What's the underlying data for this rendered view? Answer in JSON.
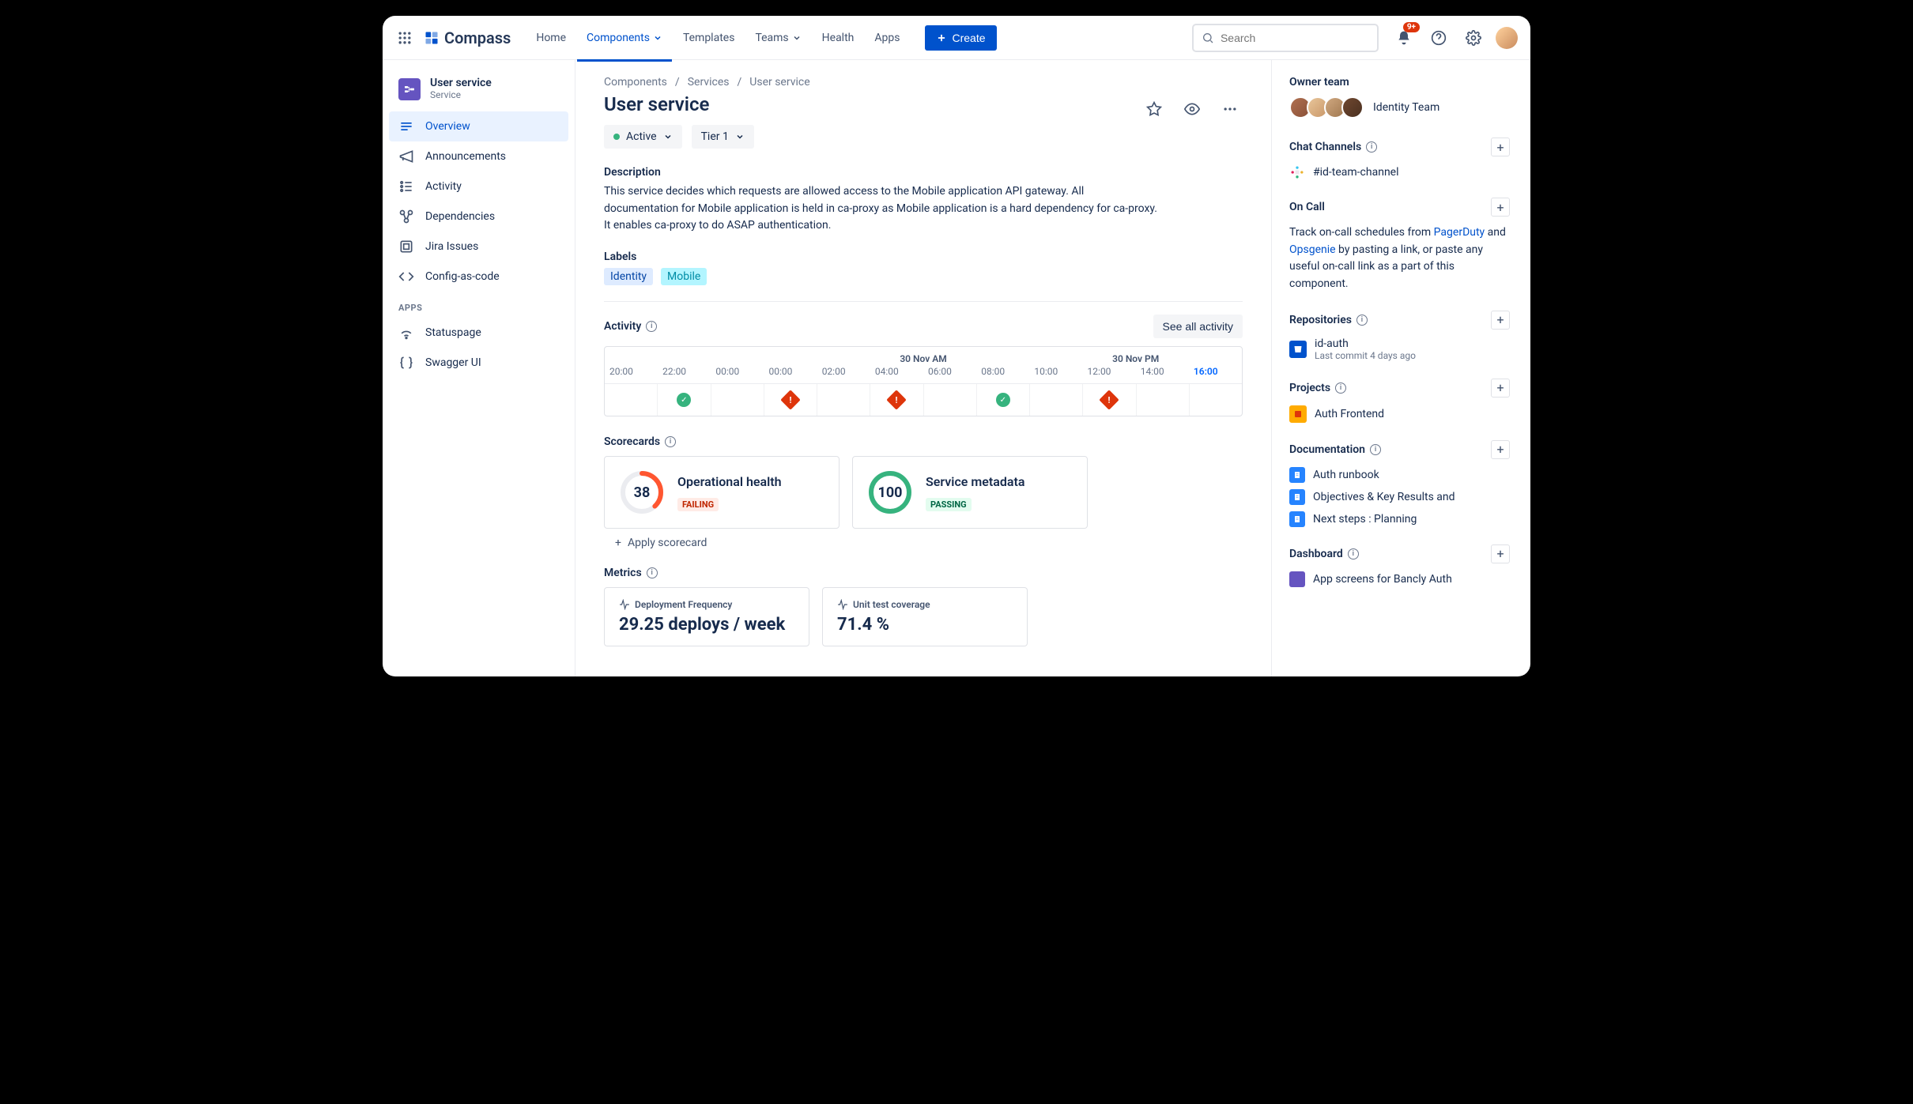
{
  "product": "Compass",
  "nav": {
    "items": [
      "Home",
      "Components",
      "Templates",
      "Teams",
      "Health",
      "Apps"
    ],
    "active": "Components",
    "create": "Create",
    "searchPlaceholder": "Search",
    "notifBadge": "9+"
  },
  "sidebar": {
    "title": "User service",
    "subtitle": "Service",
    "items": [
      {
        "label": "Overview",
        "icon": "overview"
      },
      {
        "label": "Announcements",
        "icon": "megaphone"
      },
      {
        "label": "Activity",
        "icon": "activity"
      },
      {
        "label": "Dependencies",
        "icon": "deps"
      },
      {
        "label": "Jira Issues",
        "icon": "jira"
      },
      {
        "label": "Config-as-code",
        "icon": "code"
      }
    ],
    "appsHeader": "APPS",
    "apps": [
      {
        "label": "Statuspage",
        "icon": "wifi"
      },
      {
        "label": "Swagger UI",
        "icon": "braces"
      }
    ]
  },
  "breadcrumb": [
    "Components",
    "Services",
    "User service"
  ],
  "page": {
    "title": "User service",
    "status": "Active",
    "tier": "Tier 1",
    "descTitle": "Description",
    "description": "This service decides which requests are allowed access to the Mobile application API gateway. All documentation for Mobile application is held in ca-proxy as Mobile application is a hard dependency for ca-proxy. It enables ca-proxy to do ASAP authentication.",
    "labelsTitle": "Labels",
    "labels": [
      "Identity",
      "Mobile"
    ]
  },
  "activity": {
    "title": "Activity",
    "seeAll": "See all activity",
    "dateAM": "30 Nov AM",
    "datePM": "30 Nov PM",
    "hours": [
      "20:00",
      "22:00",
      "00:00",
      "00:00",
      "02:00",
      "04:00",
      "06:00",
      "08:00",
      "10:00",
      "12:00",
      "14:00",
      "16:00"
    ],
    "currentIndex": 11,
    "events": [
      "",
      "ok",
      "",
      "fail",
      "",
      "fail",
      "",
      "ok",
      "",
      "fail",
      "",
      ""
    ]
  },
  "scorecards": {
    "title": "Scorecards",
    "apply": "Apply scorecard",
    "cards": [
      {
        "score": "38",
        "pct": 38,
        "title": "Operational health",
        "status": "FAILING",
        "color": "#FF5630"
      },
      {
        "score": "100",
        "pct": 100,
        "title": "Service metadata",
        "status": "PASSING",
        "color": "#36B37E"
      }
    ]
  },
  "metrics": {
    "title": "Metrics",
    "cards": [
      {
        "label": "Deployment Frequency",
        "value": "29.25 deploys / week"
      },
      {
        "label": "Unit test coverage",
        "value": "71.4 %"
      }
    ]
  },
  "right": {
    "ownerTitle": "Owner team",
    "teamName": "Identity Team",
    "chat": {
      "title": "Chat Channels",
      "channel": "#id-team-channel"
    },
    "oncall": {
      "title": "On Call",
      "textPre": "Track on-call schedules from ",
      "link1": "PagerDuty",
      "textMid": " and ",
      "link2": "Opsgenie",
      "textPost": " by pasting a link, or paste any useful on-call link as a part of this component."
    },
    "repos": {
      "title": "Repositories",
      "name": "id-auth",
      "meta": "Last commit 4 days ago"
    },
    "projects": {
      "title": "Projects",
      "name": "Auth Frontend"
    },
    "docs": {
      "title": "Documentation",
      "items": [
        "Auth runbook",
        "Objectives & Key Results and",
        "Next steps : Planning"
      ]
    },
    "dashboard": {
      "title": "Dashboard",
      "item": "App screens for Bancly Auth"
    }
  }
}
